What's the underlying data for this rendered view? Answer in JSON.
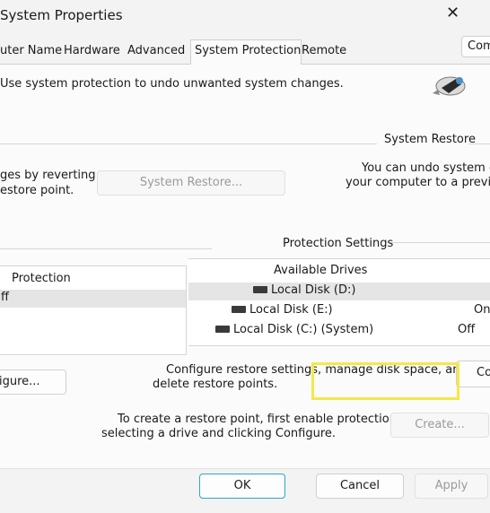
{
  "window": {
    "title": "System Properties"
  },
  "tabs": [
    {
      "label": "uter Name"
    },
    {
      "label": "Hardware"
    },
    {
      "label": "Advanced"
    },
    {
      "label": "System Protection",
      "active": true
    },
    {
      "label": "Remote"
    }
  ],
  "header": {
    "description": "Use system protection to undo unwanted system changes.",
    "comp_button": "Comp"
  },
  "system_restore": {
    "group_label": "System Restore",
    "left_text_1": "ges by reverting",
    "left_text_2": "estore point.",
    "right_text_1": "You can undo system ch",
    "right_text_2": "your computer to a previous",
    "button": "System Restore..."
  },
  "protection_settings": {
    "group_label": "Protection Settings",
    "left_header": "Protection",
    "left_value": "ff",
    "col_header": "Available Drives",
    "drives": [
      {
        "name": "Local Disk (D:)",
        "status": ""
      },
      {
        "name": "Local Disk (E:)",
        "status": "On"
      },
      {
        "name": "Local Disk (C:) (System)",
        "status": "Off"
      }
    ]
  },
  "configure": {
    "left_button": "igure...",
    "text_1": "Configure restore settings, manage disk space, and",
    "text_2": "delete restore points.",
    "button": "Co"
  },
  "create": {
    "text_1": "To create a restore point, first enable protection by",
    "text_2": "selecting a drive and clicking Configure.",
    "button": "Create..."
  },
  "footer": {
    "ok": "OK",
    "cancel": "Cancel",
    "apply": "Apply"
  },
  "colors": {
    "highlight": "#f5e84a",
    "ok_border": "#2aa7c9"
  }
}
